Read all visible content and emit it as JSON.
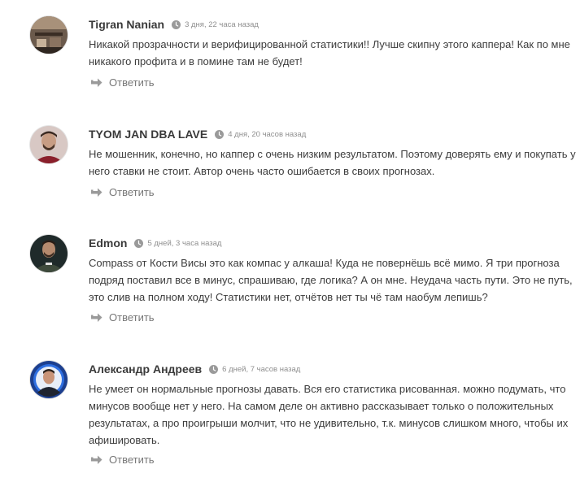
{
  "comments": [
    {
      "author": "Tigran Nanian",
      "time": "3 дня, 22 часа назад",
      "text": "Никакой прозрачности и верифицированной статистики!! Лучше скипну этого каппера! Как по мне никакого профита и в помине там не будет!",
      "reply_label": "Ответить"
    },
    {
      "author": "TYOM JAN DBA LAVE",
      "time": "4 дня, 20 часов назад",
      "text": "Не мошенник, конечно, но каппер с очень низким результатом. Поэтому доверять ему и покупать у него ставки не стоит. Автор очень часто ошибается в своих прогнозах.",
      "reply_label": "Ответить"
    },
    {
      "author": "Edmon",
      "time": "5 дней, 3 часа назад",
      "text": "Compass от Кости Висы это как компас у алкаша! Куда не повернёшь всё мимо. Я три прогноза подряд поставил все в минус, спрашиваю, где логика? А он мне. Неудача часть пути. Это не путь, это слив на полном ходу! Статистики нет, отчётов нет ты чё там наобум лепишь?",
      "reply_label": "Ответить"
    },
    {
      "author": "Александр Андреев",
      "time": "6 дней, 7 часов назад",
      "text": "Не умеет он нормальные прогнозы давать. Вся его статистика рисованная. можно подумать, что минусов вообще нет у него. На самом деле он активно рассказывает только о положительных результатах, а про проигрыши молчит, что не удивительно, т.к. минусов слишком много, чтобы их афишировать.",
      "reply_label": "Ответить"
    }
  ],
  "icons": {
    "clock": "clock-icon",
    "reply": "reply-arrow-icon"
  },
  "colors": {
    "author": "#3a3a3a",
    "meta": "#8f8f8f",
    "text": "#3c3c3c",
    "reply": "#777777",
    "icon": "#9a9a9a"
  }
}
